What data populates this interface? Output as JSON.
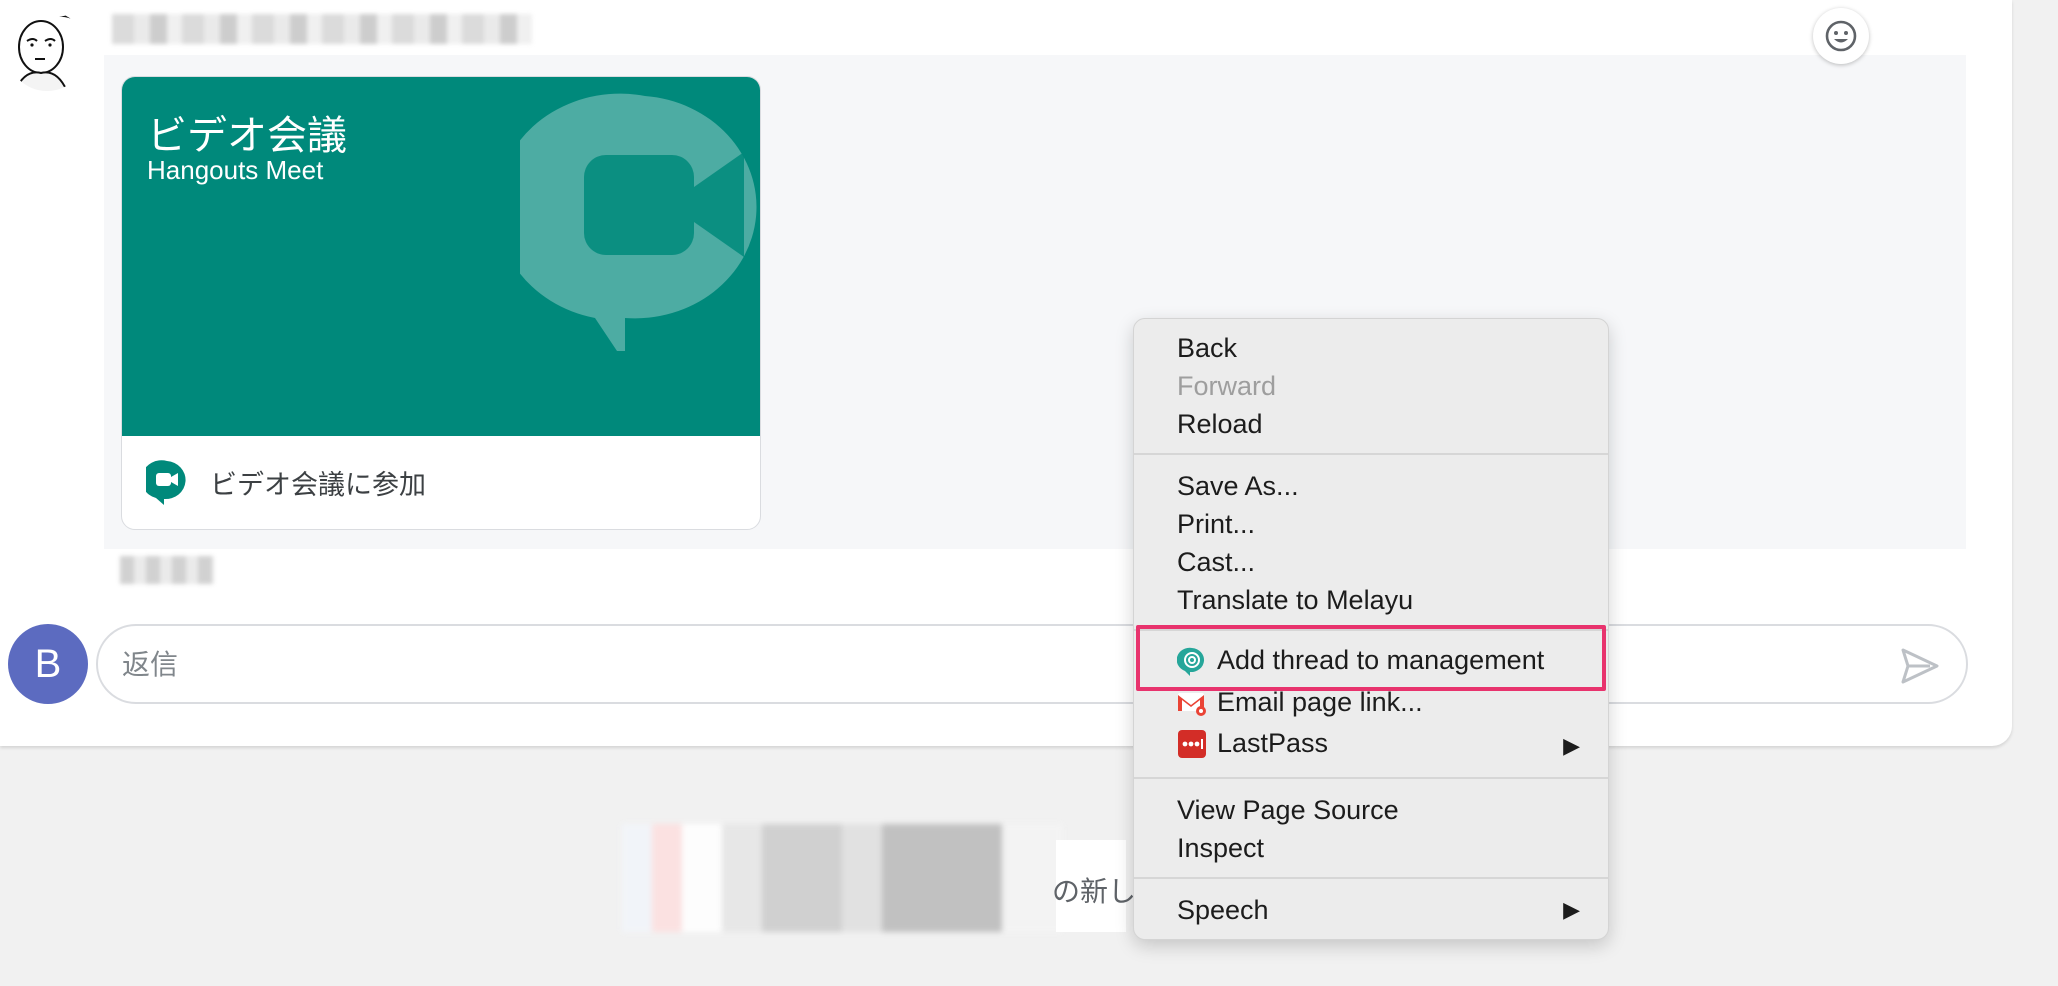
{
  "message": {
    "sender_blurred": true,
    "card": {
      "title": "ビデオ会議",
      "subtitle": "Hangouts Meet",
      "join_label": "ビデオ会議に参加",
      "brand_color": "#00897b"
    }
  },
  "reply": {
    "avatar_letter": "B",
    "placeholder": "返信"
  },
  "toast": {
    "text_fragment": "の新し"
  },
  "context_menu": {
    "nav": [
      {
        "label": "Back",
        "enabled": true
      },
      {
        "label": "Forward",
        "enabled": false
      },
      {
        "label": "Reload",
        "enabled": true
      }
    ],
    "page": [
      {
        "label": "Save As..."
      },
      {
        "label": "Print..."
      },
      {
        "label": "Cast..."
      },
      {
        "label": "Translate to Melayu"
      }
    ],
    "extensions": [
      {
        "label": "Add thread to management",
        "icon": "at-chat-icon",
        "highlighted": true
      },
      {
        "label": "Email page link...",
        "icon": "gmail-icon"
      },
      {
        "label": "LastPass",
        "icon": "lastpass-icon",
        "submenu": true
      }
    ],
    "dev": [
      {
        "label": "View Page Source"
      },
      {
        "label": "Inspect"
      }
    ],
    "speech": {
      "label": "Speech",
      "submenu": true
    },
    "submenu_arrow": "▶",
    "highlight_color": "#e8336d"
  }
}
